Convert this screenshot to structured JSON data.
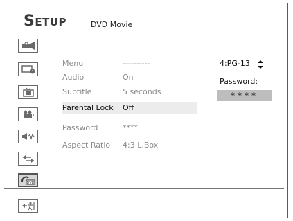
{
  "header": {
    "title": "Setup",
    "subtitle": "DVD Movie"
  },
  "sidebar": {
    "items": [
      {
        "icon": "disc-icon",
        "active": false
      },
      {
        "icon": "display-clock-icon",
        "active": false
      },
      {
        "icon": "tv-icon",
        "active": false
      },
      {
        "icon": "speaker-person-icon",
        "active": false
      },
      {
        "icon": "audio-speaker-icon",
        "active": false
      },
      {
        "icon": "arrows-exchange-icon",
        "active": false
      },
      {
        "icon": "dvd-settings-icon",
        "active": true
      },
      {
        "icon": "exit-icon",
        "active": false
      }
    ]
  },
  "menu": {
    "rows": [
      {
        "label": "Menu",
        "value": "----------"
      },
      {
        "label": "Audio",
        "value": "On"
      },
      {
        "label": "Subtitle",
        "value": "5 seconds"
      },
      {
        "label": "Parental Lock",
        "value": "Off",
        "selected": true
      },
      {
        "label": "Password",
        "value": "****"
      },
      {
        "label": "Aspect Ratio",
        "value": "4:3 L.Box"
      }
    ]
  },
  "right_panel": {
    "rating": "4:PG-13",
    "password_label": "Password:",
    "password_value": "****"
  },
  "colors": {
    "frame": "#5a5a5a",
    "selected_row": "#ececec",
    "password_box": "#bdbdbd",
    "inactive_text": "#8a8a8a",
    "active_text": "#111111"
  }
}
